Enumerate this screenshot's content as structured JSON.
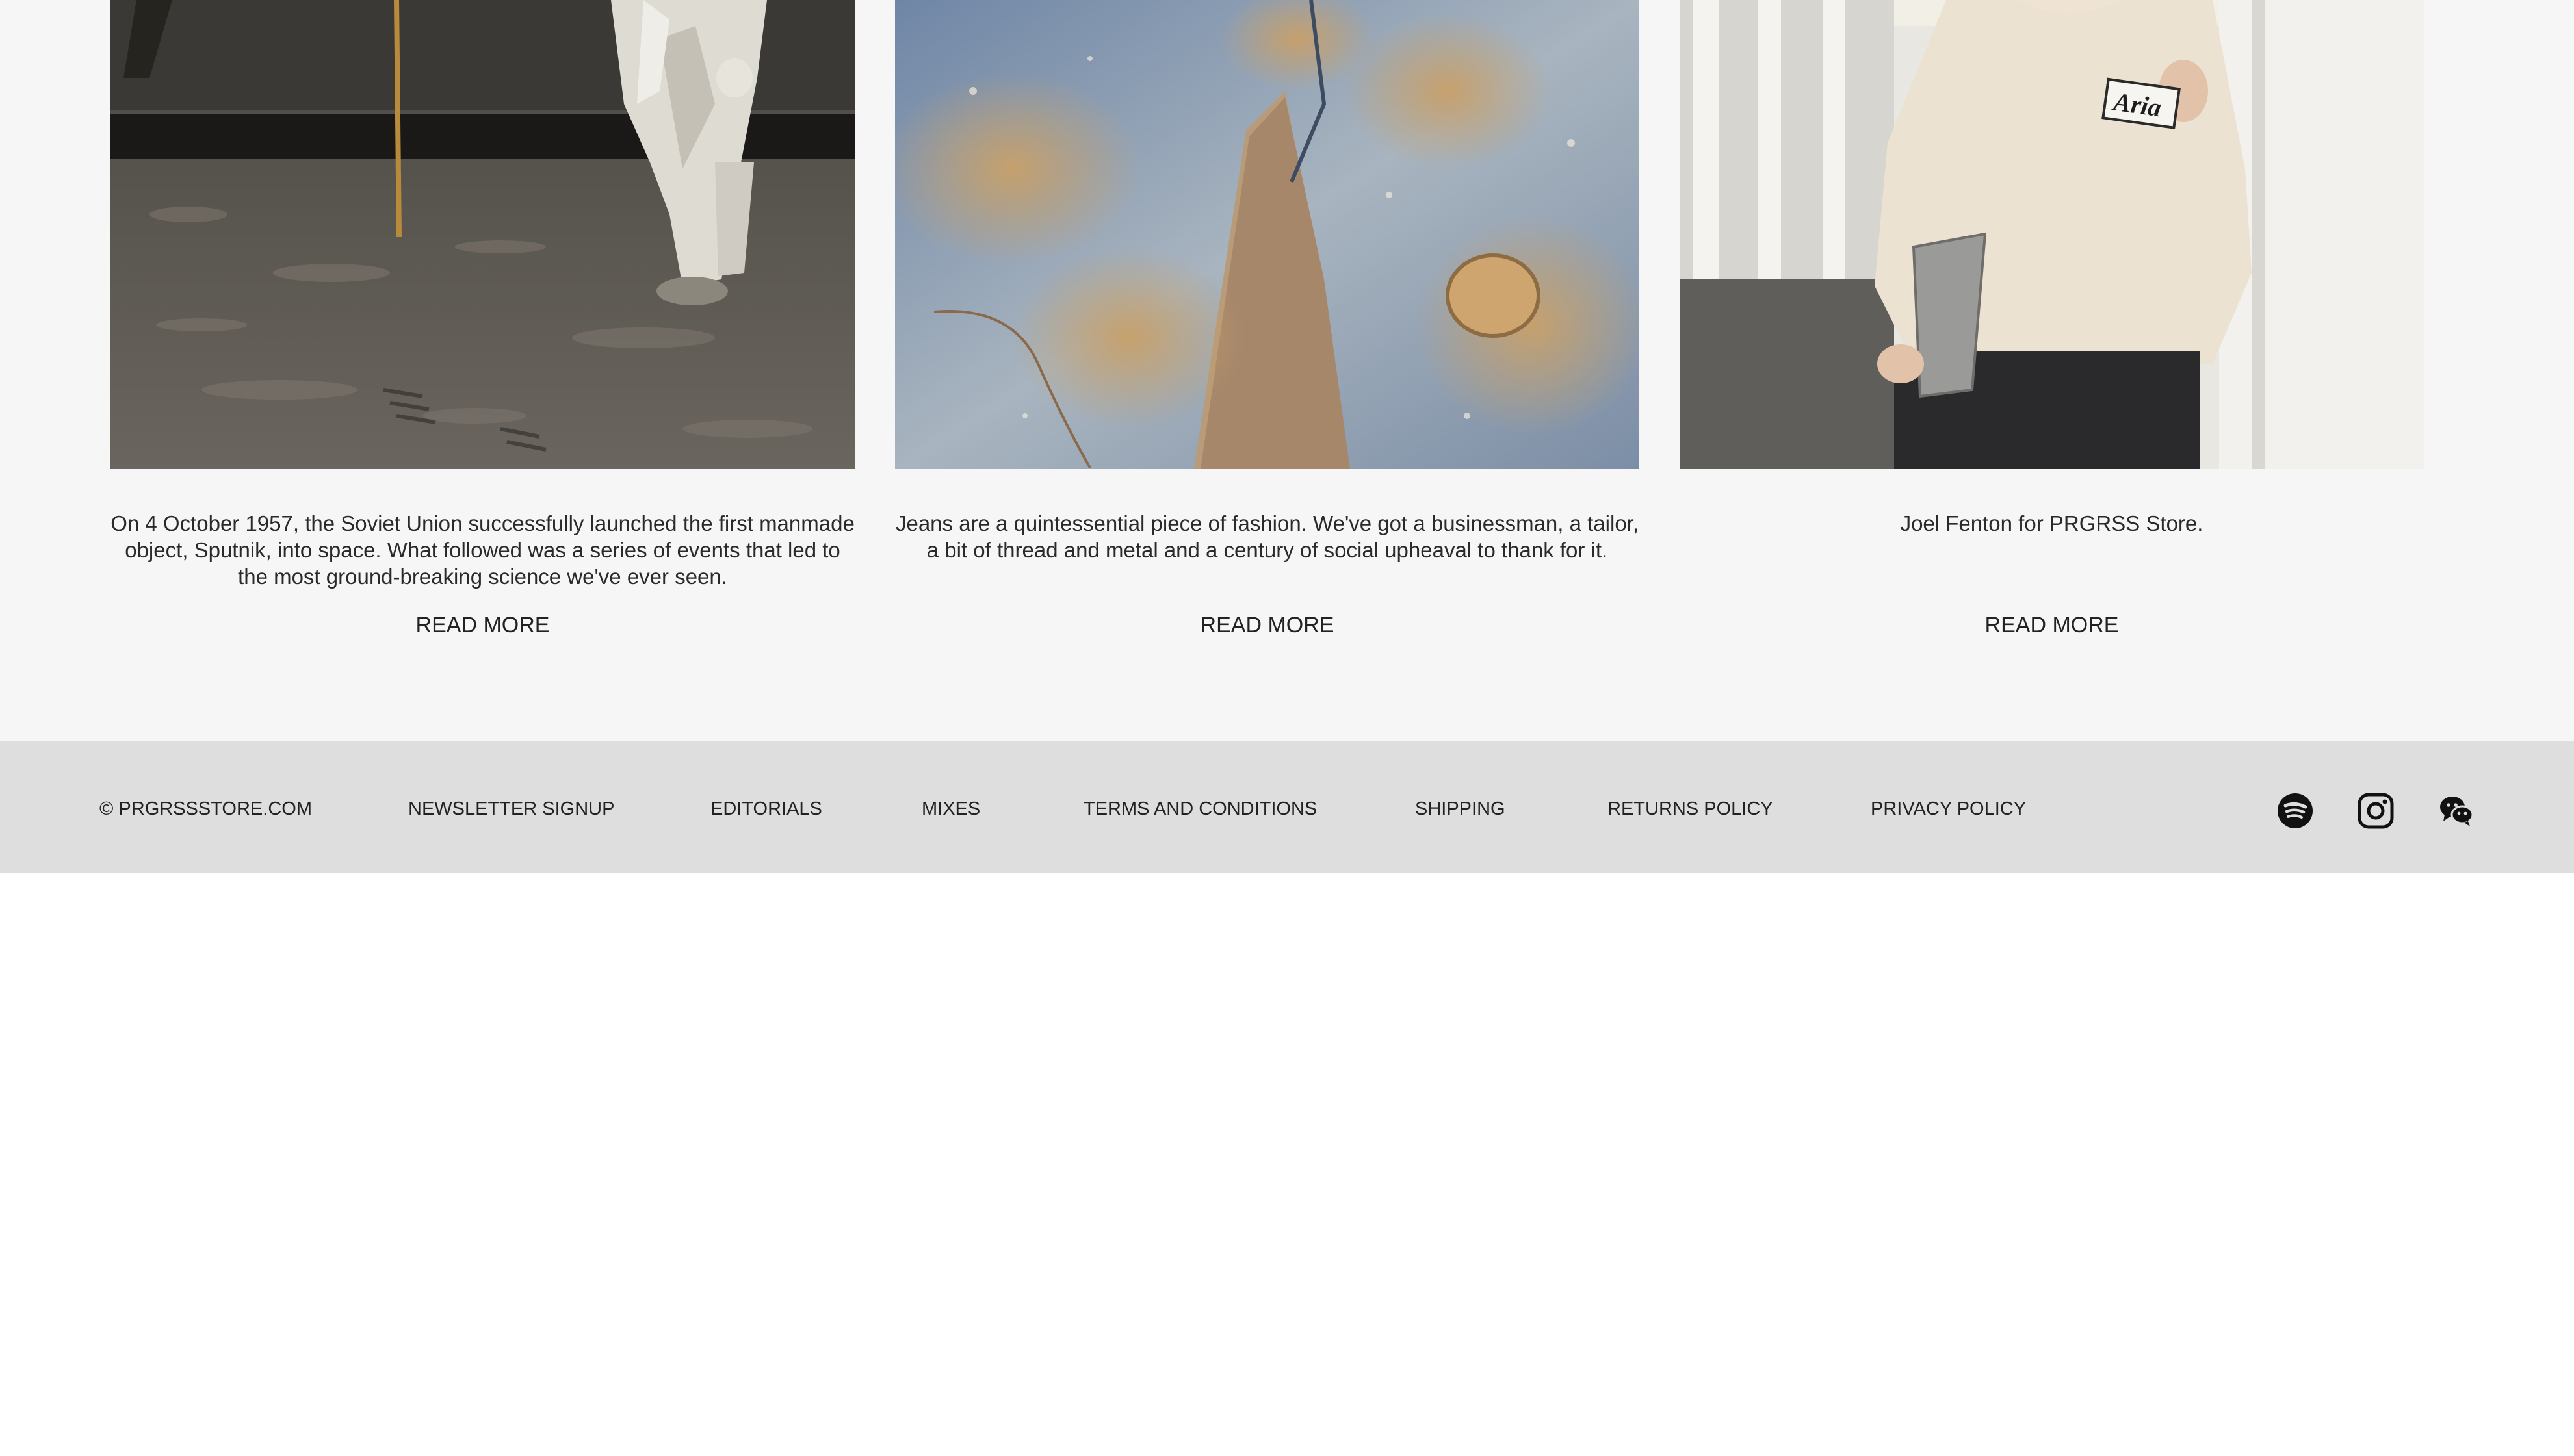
{
  "cards": [
    {
      "image_name": "astronaut-on-moon-photo",
      "text": "On 4 October 1957, the Soviet Union successfully launched the first manmade object, Sputnik, into space. What followed was a series of events that led to the most ground-breaking science we've ever seen.",
      "link": "READ MORE"
    },
    {
      "image_name": "worn-jeans-photo",
      "text": "Jeans are a quintessential piece of fashion. We've got a businessman, a tailor, a bit of thread and metal and a century of social upheaval to thank for it.",
      "link": "READ MORE"
    },
    {
      "image_name": "man-in-sweatshirt-photo",
      "sweatshirt_print": "Aria",
      "text": "Joel Fenton for PRGRSS Store.",
      "link": "READ MORE"
    }
  ],
  "footer": {
    "copyright": "© PRGRSSSTORE.COM",
    "links": {
      "newsletter": "NEWSLETTER SIGNUP",
      "editorials": "EDITORIALS",
      "mixes": "MIXES",
      "terms": "TERMS AND CONDITIONS",
      "shipping": "SHIPPING",
      "returns": "RETURNS POLICY",
      "privacy": "PRIVACY POLICY"
    },
    "social_icons": [
      "spotify-icon",
      "instagram-icon",
      "wechat-icon"
    ]
  },
  "colors": {
    "content_background": "#f6f6f6",
    "footer_background": "#dedede",
    "text": "#222222"
  }
}
